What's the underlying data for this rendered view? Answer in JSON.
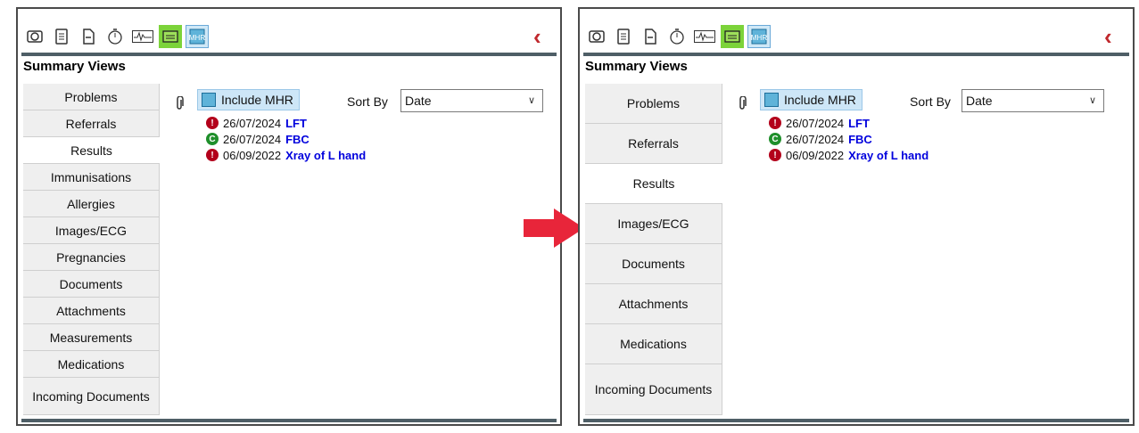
{
  "colors": {
    "accent_red": "#c0282d",
    "link_blue": "#0000dd",
    "abnormal": "#b3001b",
    "normal": "#1f8f2b",
    "arrow": "#e8253a"
  },
  "toolbar_icons": [
    "camera-icon",
    "notepad-icon",
    "document-icon",
    "stopwatch-icon",
    "ecg-icon",
    "image-folder-icon",
    "mhr-icon"
  ],
  "left": {
    "title": "Summary Views",
    "tabs": [
      "Problems",
      "Referrals",
      "Results",
      "Immunisations",
      "Allergies",
      "Images/ECG",
      "Pregnancies",
      "Documents",
      "Attachments",
      "Measurements",
      "Medications",
      "Incoming Documents"
    ],
    "active_tab": "Results",
    "include_mhr": "Include MHR",
    "sort_by_label": "Sort By",
    "sort_by_value": "Date",
    "results": [
      {
        "status": "abnormal",
        "badge": "!",
        "date": "26/07/2024",
        "name": "LFT"
      },
      {
        "status": "normal",
        "badge": "C",
        "date": "26/07/2024",
        "name": "FBC"
      },
      {
        "status": "abnormal",
        "badge": "!",
        "date": "06/09/2022",
        "name": "Xray of L hand"
      }
    ]
  },
  "right": {
    "title": "Summary Views",
    "tabs": [
      "Problems",
      "Referrals",
      "Results",
      "Images/ECG",
      "Documents",
      "Attachments",
      "Medications",
      "Incoming Documents"
    ],
    "active_tab": "Results",
    "include_mhr": "Include MHR",
    "sort_by_label": "Sort By",
    "sort_by_value": "Date",
    "results": [
      {
        "status": "abnormal",
        "badge": "!",
        "date": "26/07/2024",
        "name": "LFT"
      },
      {
        "status": "normal",
        "badge": "C",
        "date": "26/07/2024",
        "name": "FBC"
      },
      {
        "status": "abnormal",
        "badge": "!",
        "date": "06/09/2022",
        "name": "Xray of L hand"
      }
    ]
  }
}
